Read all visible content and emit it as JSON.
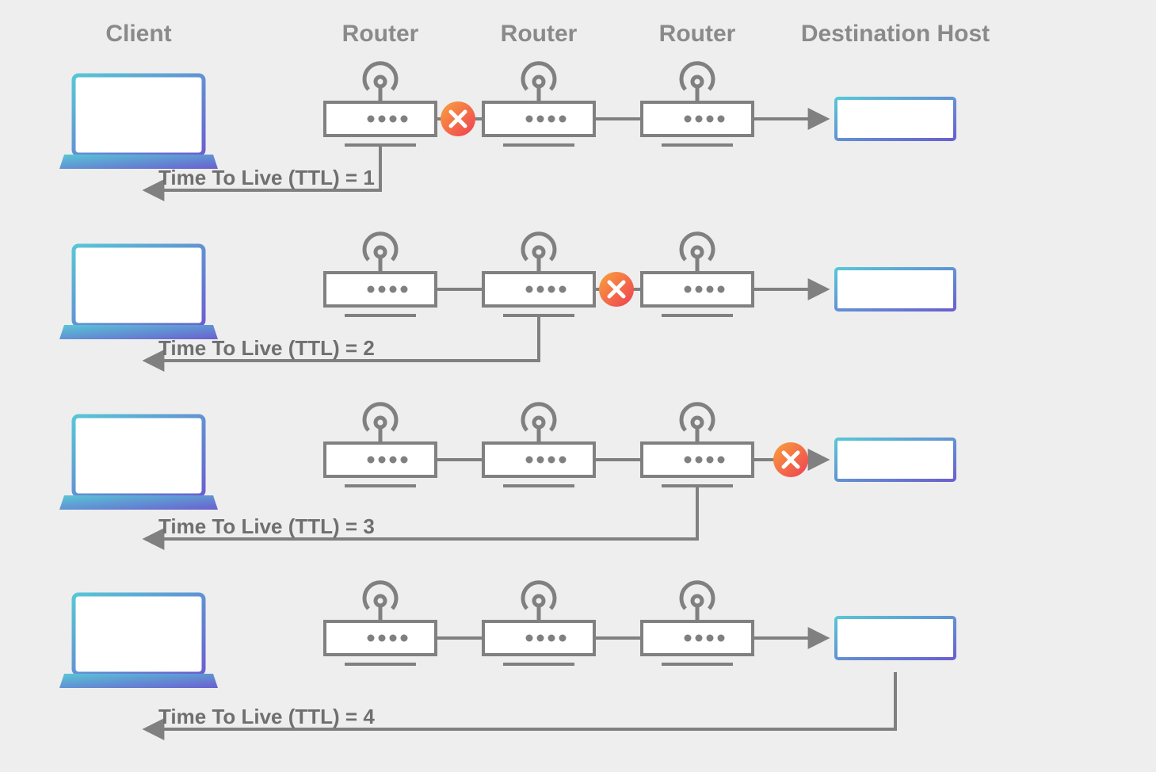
{
  "headers": {
    "client": "Client",
    "router1": "Router",
    "router2": "Router",
    "router3": "Router",
    "destination": "Destination Host"
  },
  "rows": [
    {
      "ttl_label": "Time To Live (TTL) = 1",
      "block_after_hop": 1
    },
    {
      "ttl_label": "Time To Live (TTL) = 2",
      "block_after_hop": 2
    },
    {
      "ttl_label": "Time To Live (TTL) = 3",
      "block_after_hop": 3
    },
    {
      "ttl_label": "Time To Live (TTL) = 4",
      "block_after_hop": 0
    }
  ],
  "colors": {
    "text": "#7a7a7a",
    "line": "#808080",
    "router": "#808080",
    "grad_a": "#58c6d6",
    "grad_b": "#6a5fd0",
    "x_a": "#f9a23c",
    "x_b": "#ef3e53"
  }
}
